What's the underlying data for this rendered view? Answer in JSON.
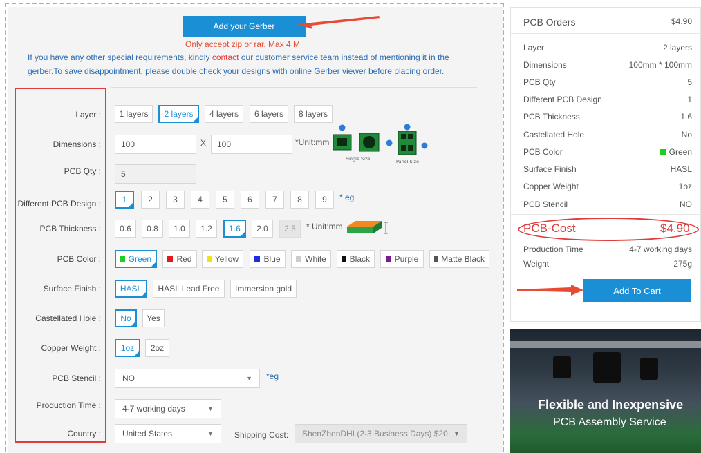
{
  "gerber": {
    "button": "Add your Gerber",
    "accept_note": "Only accept zip or rar, Max 4 M",
    "info_before": "If you have any other special requirements, kindly ",
    "info_link": "contact",
    "info_after": " our customer service team instead of mentioning it in the",
    "info_line2": "gerber.To save disappointment, please double check your designs with online Gerber viewer before placing order."
  },
  "labels": {
    "layer": "Layer :",
    "dimensions": "Dimensions :",
    "qty": "PCB Qty :",
    "design": "Different PCB Design :",
    "thickness": "PCB Thickness :",
    "color": "PCB Color :",
    "finish": "Surface Finish :",
    "castellated": "Castellated Hole :",
    "copper": "Copper Weight :",
    "stencil": "PCB Stencil :",
    "production": "Production Time :",
    "country": "Country :"
  },
  "layer_options": [
    "1 layers",
    "2 layers",
    "4 layers",
    "6 layers",
    "8 layers"
  ],
  "dimensions": {
    "w": "100",
    "x": "X",
    "h": "100",
    "unit": "*Unit:mm",
    "single": "Single Size",
    "panel": "Panel Size"
  },
  "qty": "5",
  "design_options": [
    "1",
    "2",
    "3",
    "4",
    "5",
    "6",
    "7",
    "8",
    "9"
  ],
  "design_eg": "* eg",
  "thickness_options": [
    "0.6",
    "0.8",
    "1.0",
    "1.2",
    "1.6",
    "2.0",
    "2.5"
  ],
  "thickness_unit": "* Unit:mm",
  "color_options": [
    {
      "label": "Green",
      "swatch": "#22cc22"
    },
    {
      "label": "Red",
      "swatch": "#e01b1b"
    },
    {
      "label": "Yellow",
      "swatch": "#f2e21a"
    },
    {
      "label": "Blue",
      "swatch": "#1b2fe0"
    },
    {
      "label": "White",
      "swatch": "#cccccc"
    },
    {
      "label": "Black",
      "swatch": "#111111"
    },
    {
      "label": "Purple",
      "swatch": "#7a1b8f"
    },
    {
      "label": "Matte Black",
      "swatch": "#555555"
    }
  ],
  "finish_options": [
    "HASL",
    "HASL Lead Free",
    "Immersion gold"
  ],
  "castellated_options": [
    "No",
    "Yes"
  ],
  "copper_options": [
    "1oz",
    "2oz"
  ],
  "stencil": {
    "value": "NO",
    "eg": "*eg"
  },
  "production": "4-7 working days",
  "country": "United States",
  "shipping": {
    "label": "Shipping Cost:",
    "value": "ShenZhenDHL(2-3 Business Days) $20"
  },
  "order": {
    "title": "PCB Orders",
    "total": "$4.90",
    "rows": [
      {
        "k": "Layer",
        "v": "2 layers"
      },
      {
        "k": "Dimensions",
        "v": "100mm * 100mm"
      },
      {
        "k": "PCB Qty",
        "v": "5"
      },
      {
        "k": "Different PCB Design",
        "v": "1"
      },
      {
        "k": "PCB Thickness",
        "v": "1.6"
      },
      {
        "k": "Castellated Hole",
        "v": "No"
      },
      {
        "k": "PCB Color",
        "v": "Green"
      },
      {
        "k": "Surface Finish",
        "v": "HASL"
      },
      {
        "k": "Copper Weight",
        "v": "1oz"
      },
      {
        "k": "PCB Stencil",
        "v": "NO"
      }
    ],
    "cost_label": "PCB-Cost",
    "cost_value": "$4.90",
    "production_label": "Production Time",
    "production_value": "4-7 working days",
    "weight_label": "Weight",
    "weight_value": "275g",
    "cart_button": "Add To Cart",
    "accent": "#1b8fd6"
  },
  "ad": {
    "line1a": "Flexible",
    "line1b": " and ",
    "line1c": "Inexpensive",
    "line2": "PCB Assembly Service"
  }
}
